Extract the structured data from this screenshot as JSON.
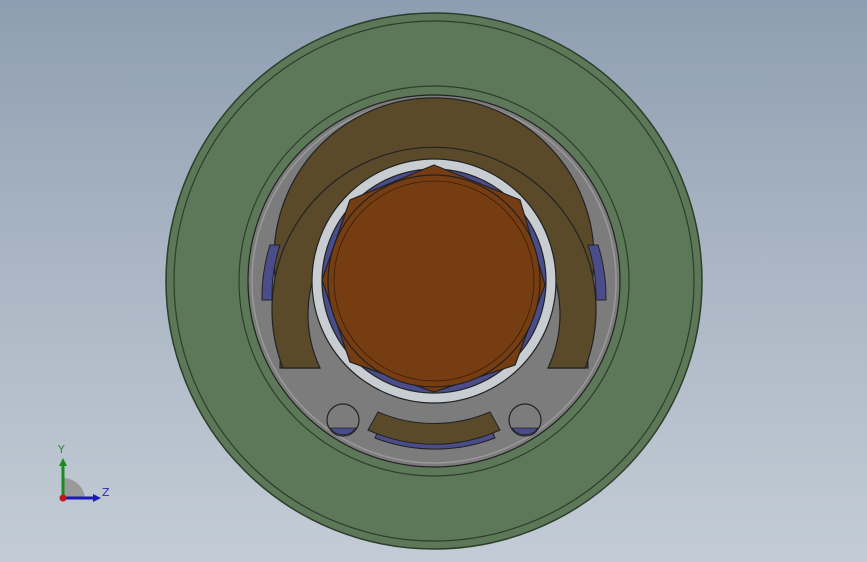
{
  "triad": {
    "y_label": "Y",
    "z_label": "Z",
    "y_color": "#1d8a1d",
    "z_color": "#1a1ab8",
    "origin_color": "#c01818"
  },
  "model": {
    "colors": {
      "outer_ring": "#5c7858",
      "outer_edge": "#2d3d2a",
      "housing_gray": "#7c7c7c",
      "bracket_brown": "#5a4a2a",
      "blue_ring": "#4a4d8a",
      "ball_gray": "#c8cdd2",
      "core_brown": "#773d12",
      "edge_dark": "#222222"
    }
  }
}
